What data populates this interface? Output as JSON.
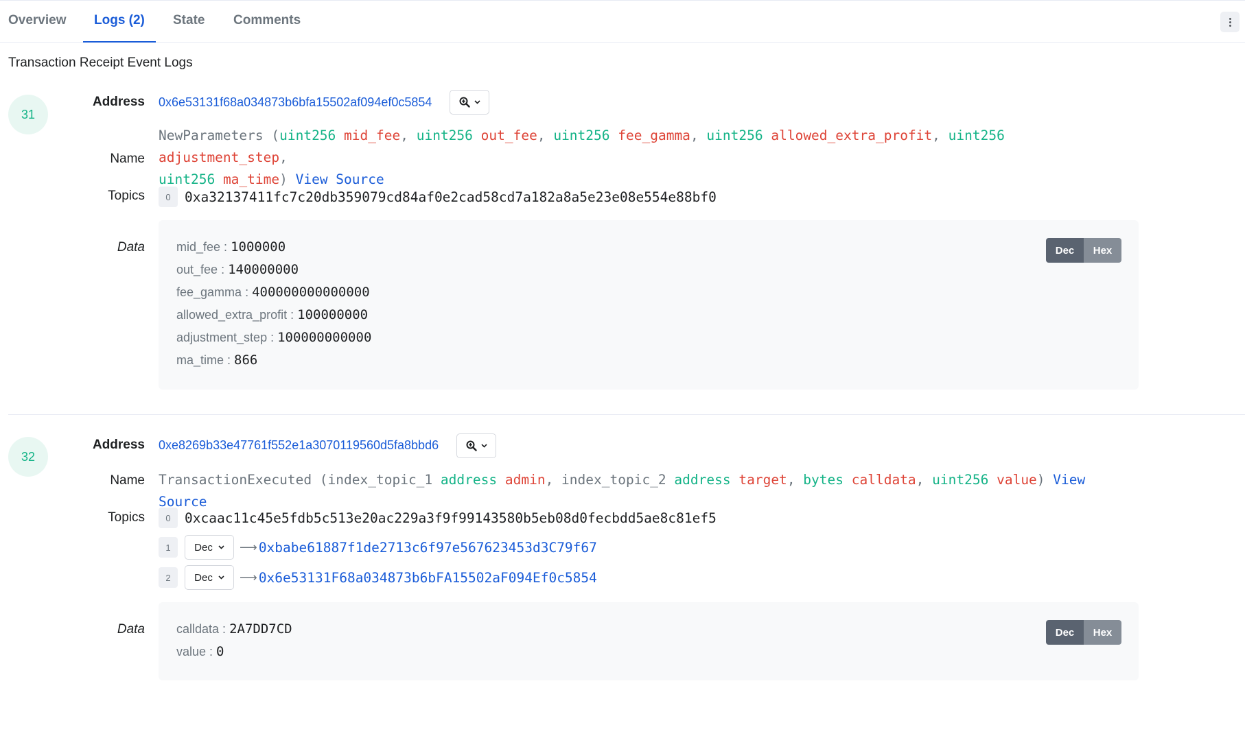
{
  "tabs": [
    {
      "label": "Overview"
    },
    {
      "label": "Logs (2)"
    },
    {
      "label": "State"
    },
    {
      "label": "Comments"
    }
  ],
  "section_title": "Transaction Receipt Event Logs",
  "labels": {
    "address": "Address",
    "name": "Name",
    "topics": "Topics",
    "data": "Data",
    "view_source": "View Source",
    "dec": "Dec",
    "hex": "Hex",
    "colon": " : "
  },
  "logs": [
    {
      "index": "31",
      "address": "0x6e53131f68a034873b6bfa15502af094ef0c5854",
      "event_name": "NewParameters",
      "params": [
        {
          "type": "uint256",
          "name": "mid_fee"
        },
        {
          "type": "uint256",
          "name": "out_fee"
        },
        {
          "type": "uint256",
          "name": "fee_gamma"
        },
        {
          "type": "uint256",
          "name": "allowed_extra_profit"
        },
        {
          "type": "uint256",
          "name": "adjustment_step"
        },
        {
          "type": "uint256",
          "name": "ma_time"
        }
      ],
      "topics": [
        {
          "index": "0",
          "value": "0xa32137411fc7c20db359079cd84af0e2cad58cd7a182a8a5e23e08e554e88bf0"
        }
      ],
      "data": [
        {
          "key": "mid_fee",
          "value": "1000000"
        },
        {
          "key": "out_fee",
          "value": "140000000"
        },
        {
          "key": "fee_gamma",
          "value": "400000000000000"
        },
        {
          "key": "allowed_extra_profit",
          "value": "100000000"
        },
        {
          "key": "adjustment_step",
          "value": "100000000000"
        },
        {
          "key": "ma_time",
          "value": "866"
        }
      ]
    },
    {
      "index": "32",
      "address": "0xe8269b33e47761f552e1a3070119560d5fa8bbd6",
      "event_name": "TransactionExecuted",
      "params": [
        {
          "prefix": "index_topic_1",
          "type": "address",
          "name": "admin"
        },
        {
          "prefix": "index_topic_2",
          "type": "address",
          "name": "target"
        },
        {
          "type": "bytes",
          "name": "calldata"
        },
        {
          "type": "uint256",
          "name": "value"
        }
      ],
      "topics": [
        {
          "index": "0",
          "value": "0xcaac11c45e5fdb5c513e20ac229a3f9f99143580b5eb08d0fecbdd5ae8c81ef5"
        },
        {
          "index": "1",
          "format": "Dec",
          "value": "0xbabe61887f1de2713c6f97e567623453d3C79f67"
        },
        {
          "index": "2",
          "format": "Dec",
          "value": "0x6e53131F68a034873b6bFA15502aF094Ef0c5854"
        }
      ],
      "data": [
        {
          "key": "calldata",
          "value": "2A7DD7CD"
        },
        {
          "key": "value",
          "value": "0"
        }
      ]
    }
  ]
}
